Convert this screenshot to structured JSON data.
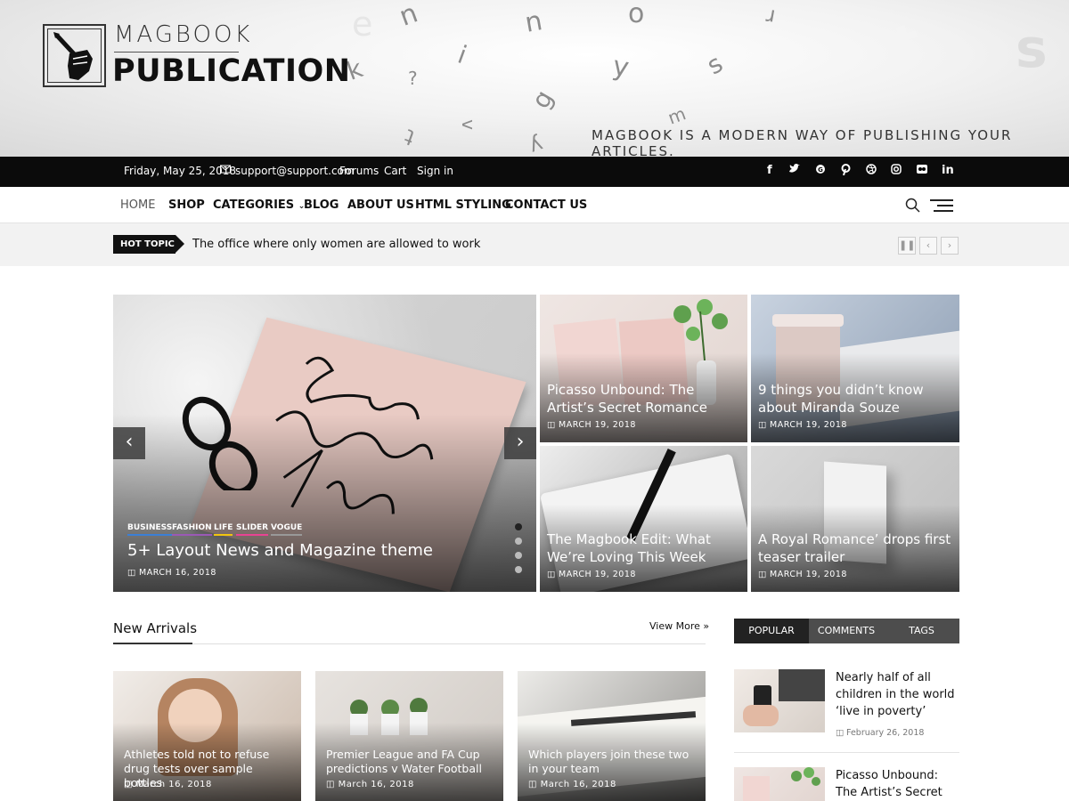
{
  "header": {
    "site_title_top": "MAGBOOK",
    "site_title": "PUBLICATION",
    "tagline": "MAGBOOK IS A MODERN WAY OF PUBLISHING YOUR ARTICLES."
  },
  "topbar": {
    "date": "Friday, May 25, 2018",
    "email": "support@support.com",
    "links": [
      "Forums",
      "Cart",
      "Sign in"
    ],
    "social": [
      "facebook-icon",
      "twitter-icon",
      "google-plus-icon",
      "pinterest-icon",
      "dribbble-icon",
      "instagram-icon",
      "flickr-icon",
      "linkedin-icon"
    ]
  },
  "nav": {
    "items": [
      "HOME",
      "SHOP",
      "CATEGORIES",
      "BLOG",
      "ABOUT US",
      "HTML STYLING",
      "CONTACT US"
    ]
  },
  "hot_topic": {
    "label": "HOT TOPIC",
    "text": "The office where only women are allowed to work"
  },
  "slider": {
    "categories": [
      "BUSINESS",
      "FASHION",
      "LIFE",
      "SLIDER",
      "VOGUE"
    ],
    "category_colors": [
      "#3b7fd6",
      "#9b59b6",
      "#f1c40f",
      "#e84393",
      "#999999"
    ],
    "title": "5+ Layout News and Magazine theme",
    "date": "MARCH 16, 2018",
    "prev": "‹",
    "next": "›"
  },
  "grid": [
    {
      "title": "Picasso Unbound: The Artist’s Secret Romance",
      "date": "MARCH 19, 2018"
    },
    {
      "title": "9 things you didn’t know about Miranda Souze",
      "date": "MARCH 19, 2018"
    },
    {
      "title": "The Magbook Edit: What We’re Loving This Week",
      "date": "MARCH 19, 2018"
    },
    {
      "title": "A Royal Romance’ drops first teaser trailer",
      "date": "MARCH 19, 2018"
    }
  ],
  "new_arrivals": {
    "title": "New Arrivals",
    "view_more": "View More »",
    "items": [
      {
        "title": "Athletes told not to refuse drug tests over sample bottles",
        "date": "March 16, 2018"
      },
      {
        "title": "Premier League and FA Cup predictions v Water Football",
        "date": "March 16, 2018"
      },
      {
        "title": "Which players join these two in your team",
        "date": "March 16, 2018"
      }
    ]
  },
  "sidebar": {
    "tabs": [
      "POPULAR",
      "COMMENTS",
      "TAGS"
    ],
    "posts": [
      {
        "title": "Nearly half of all children in the world ‘live in poverty’",
        "date": "February 26, 2018"
      },
      {
        "title": "Picasso Unbound: The Artist’s Secret",
        "date": ""
      }
    ]
  }
}
